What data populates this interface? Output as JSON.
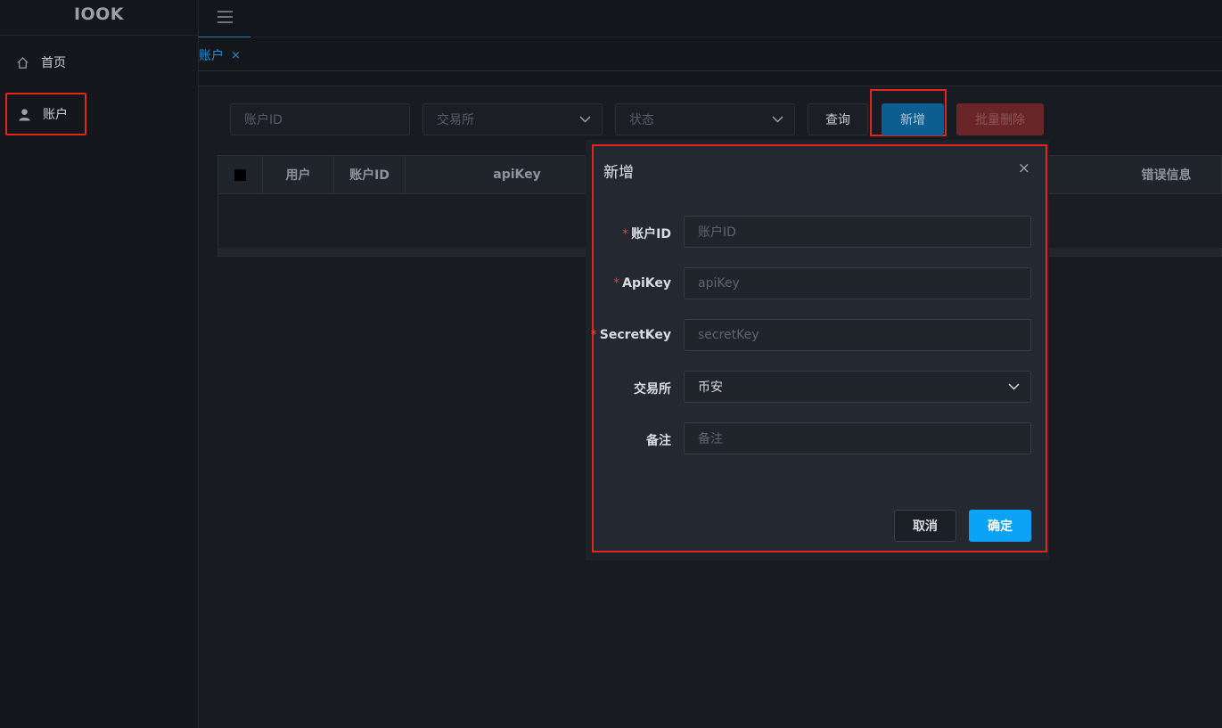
{
  "app": {
    "logo": "IOOK"
  },
  "sidebar": {
    "items": [
      {
        "label": "首页",
        "icon": "home-icon"
      },
      {
        "label": "账户",
        "icon": "user-icon"
      }
    ]
  },
  "header": {
    "menu_icon": "menu-icon"
  },
  "tabs": [
    {
      "label": "账户",
      "close": "×"
    }
  ],
  "filters": {
    "account_id_placeholder": "账户ID",
    "exchange_placeholder": "交易所",
    "status_placeholder": "状态",
    "query_label": "查询",
    "add_label": "新增",
    "batch_delete_label": "批量删除"
  },
  "table": {
    "columns": [
      "用户",
      "账户ID",
      "apiKey",
      "错误信息"
    ]
  },
  "modal": {
    "title": "新增",
    "close": "×",
    "fields": [
      {
        "label": "账户ID",
        "required": true,
        "placeholder": "账户ID"
      },
      {
        "label": "ApiKey",
        "required": true,
        "placeholder": "apiKey"
      },
      {
        "label": "SecretKey",
        "required": true,
        "placeholder": "secretKey"
      },
      {
        "label": "交易所",
        "required": false,
        "value": "币安"
      },
      {
        "label": "备注",
        "required": false,
        "placeholder": "备注"
      }
    ],
    "required_mark": "*",
    "cancel_label": "取消",
    "confirm_label": "确定"
  },
  "colors": {
    "accent": "#0aa3f5",
    "highlight": "#e0261d",
    "danger": "#6a2528"
  }
}
